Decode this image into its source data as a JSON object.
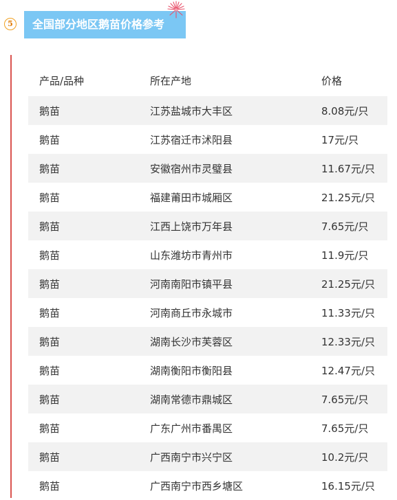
{
  "section": {
    "number": "5",
    "title": "全国部分地区鹅苗价格参考"
  },
  "colors": {
    "title_background": "#7bc7f4",
    "accent_rule": "#d9534f",
    "number_ring": "#f0a020",
    "zebra_row": "#f2f2f2"
  },
  "icons": {
    "decoration": "firework-burst-icon"
  },
  "table": {
    "headers": [
      "产品/品种",
      "所在产地",
      "价格"
    ],
    "rows": [
      [
        "鹅苗",
        "江苏盐城市大丰区",
        "8.08元/只"
      ],
      [
        "鹅苗",
        "江苏宿迁市沭阳县",
        "17元/只"
      ],
      [
        "鹅苗",
        "安徽宿州市灵璧县",
        "11.67元/只"
      ],
      [
        "鹅苗",
        "福建莆田市城厢区",
        "21.25元/只"
      ],
      [
        "鹅苗",
        "江西上饶市万年县",
        "7.65元/只"
      ],
      [
        "鹅苗",
        "山东潍坊市青州市",
        "11.9元/只"
      ],
      [
        "鹅苗",
        "河南南阳市镇平县",
        "21.25元/只"
      ],
      [
        "鹅苗",
        "河南商丘市永城市",
        "11.33元/只"
      ],
      [
        "鹅苗",
        "湖南长沙市芙蓉区",
        "12.33元/只"
      ],
      [
        "鹅苗",
        "湖南衡阳市衡阳县",
        "12.47元/只"
      ],
      [
        "鹅苗",
        "湖南常德市鼎城区",
        "7.65元/只"
      ],
      [
        "鹅苗",
        "广东广州市番禺区",
        "7.65元/只"
      ],
      [
        "鹅苗",
        "广西南宁市兴宁区",
        "10.2元/只"
      ],
      [
        "鹅苗",
        "广西南宁市西乡塘区",
        "16.15元/只"
      ]
    ]
  }
}
